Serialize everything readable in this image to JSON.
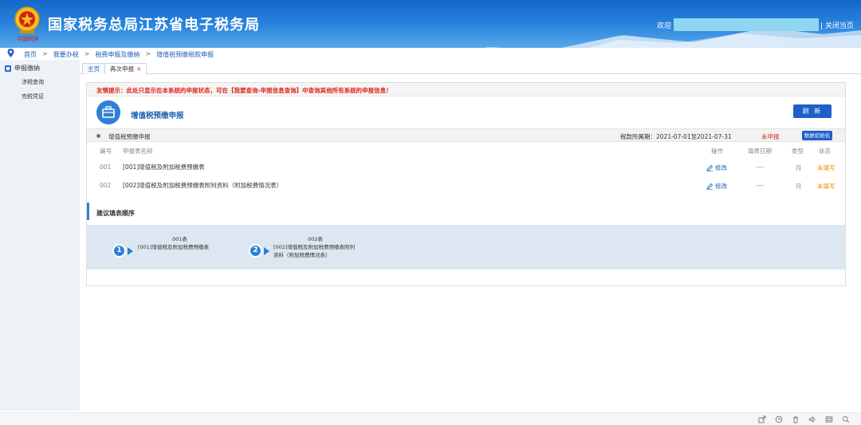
{
  "header": {
    "logo_text": "中国税务",
    "title": "国家税务总局江苏省电子税务局",
    "welcome": "欢迎",
    "close_page": "| 关闭当页"
  },
  "breadcrumb": [
    "首页",
    "我要办税",
    "税费申报及缴纳",
    "增值税预缴税款申报"
  ],
  "breadcrumb_sep": ">",
  "sidebar": {
    "header": "申报缴纳",
    "items": [
      "涉税查询",
      "完税凭证"
    ]
  },
  "tabs": {
    "home": "主页",
    "active": "再次申报",
    "close": "×"
  },
  "notice": "友情提示：此处只显示在本系统的申报状态，可在【我要查询-申报信息查询】中查询其他所有系统的申报信息！",
  "declaration": {
    "title": "增值税预缴申报",
    "refresh": "刷 新",
    "section_name": "增值税预缴申报",
    "period": "税款所属期：2021-07-01至2021-07-31",
    "status": "未申报",
    "init_button": "数据初始化"
  },
  "table": {
    "headers": {
      "no": "编号",
      "name": "申报表名称",
      "op": "操作",
      "date": "填表日期",
      "type": "类型",
      "status": "状态"
    },
    "rows": [
      {
        "no": "001",
        "name": "[001]增值税及附加税费预缴表",
        "op": "修改",
        "date": "----",
        "type": "月",
        "status": "未填写"
      },
      {
        "no": "002",
        "name": "[002]增值税及附加税费预缴表附列资料（附加税费情况表）",
        "op": "修改",
        "date": "----",
        "type": "月",
        "status": "未填写"
      }
    ]
  },
  "suggest": {
    "title": "建议填表顺序",
    "steps": [
      {
        "num": "1",
        "code": "001表",
        "name_line1": "[001]增值税及附加税费预缴表",
        "name_line2": ""
      },
      {
        "num": "2",
        "code": "002表",
        "name_line1": "[002]增值税及附加税费预缴表附列",
        "name_line2": "资料（附加税费情况表）"
      }
    ]
  },
  "colors": {
    "header_blue": "#1467c9",
    "accent_blue": "#1f5fc7",
    "warning_red": "#e0251c",
    "status_orange": "#f08a00"
  },
  "footer_icons": [
    "share-icon",
    "history-icon",
    "delete-icon",
    "volume-icon",
    "window-icon",
    "search-icon"
  ]
}
